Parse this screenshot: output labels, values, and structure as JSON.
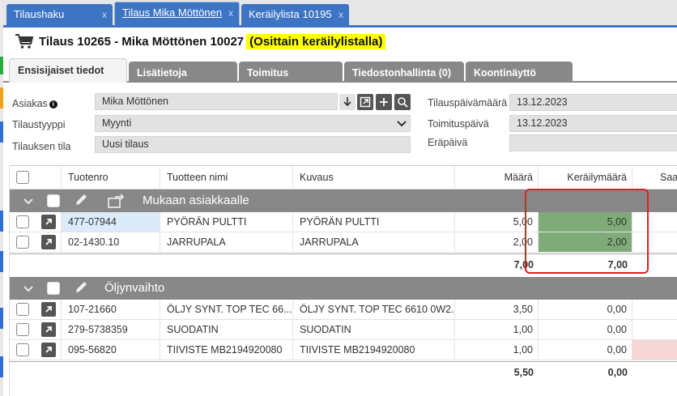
{
  "top_tabs": [
    {
      "label": "Tilaushaku",
      "close": "x"
    },
    {
      "label": "Tilaus Mika Möttönen",
      "close": "x"
    },
    {
      "label": "Keräilylista 10195",
      "close": "x"
    }
  ],
  "page_title": {
    "main": "Tilaus 10265 - Mika Möttönen 10027",
    "status": "(Osittain keräilylistalla)"
  },
  "sub_tabs": [
    "Ensisijaiset tiedot",
    "Lisätietoja",
    "Toimitus",
    "Tiedostonhallinta (0)",
    "Koontinäyttö"
  ],
  "form": {
    "asiakas_label": "Asiakas",
    "asiakas_value": "Mika Möttönen",
    "tilaustyyppi_label": "Tilaustyyppi",
    "tilaustyyppi_value": "Myynti",
    "tilauksen_tila_label": "Tilauksen tila",
    "tilauksen_tila_value": "Uusi tilaus",
    "tilauspaivamaara_label": "Tilauspäivämäärä",
    "tilauspaivamaara_value": "13.12.2023",
    "toimituspaiva_label": "Toimituspäivä",
    "toimituspaiva_value": "13.12.2023",
    "erapaiva_label": "Eräpäivä",
    "erapaiva_value": ""
  },
  "grid": {
    "headers": {
      "tuotenro": "Tuotenro",
      "nimi": "Tuotteen nimi",
      "kuvaus": "Kuvaus",
      "maara": "Määrä",
      "kerailymaara": "Keräilymäärä",
      "extra": "Saa"
    },
    "groups": [
      {
        "name": "Mukaan asiakkaalle",
        "rows": [
          {
            "tuotenro": "477-07944",
            "nimi": "PYÖRÄN PULTTI",
            "kuvaus": "PYÖRÄN PULTTI",
            "maara": "5,00",
            "kerailymaara": "5,00"
          },
          {
            "tuotenro": "02-1430.10",
            "nimi": "JARRUPALA",
            "kuvaus": "JARRUPALA",
            "maara": "2,00",
            "kerailymaara": "2,00"
          }
        ],
        "sum_maara": "7,00",
        "sum_kerailymaara": "7,00"
      },
      {
        "name": "Öljynvaihto",
        "rows": [
          {
            "tuotenro": "107-21660",
            "nimi": "ÖLJY SYNT. TOP TEC 66...",
            "kuvaus": "ÖLJY SYNT. TOP TEC 6610 0W2...",
            "maara": "3,50",
            "kerailymaara": "0,00"
          },
          {
            "tuotenro": "279-5738359",
            "nimi": "SUODATIN",
            "kuvaus": "SUODATIN",
            "maara": "1,00",
            "kerailymaara": "0,00"
          },
          {
            "tuotenro": "095-56820",
            "nimi": "TIIVISTE MB2194920080",
            "kuvaus": "TIIVISTE MB2194920080",
            "maara": "1,00",
            "kerailymaara": "0,00"
          }
        ],
        "sum_maara": "5,50",
        "sum_kerailymaara": "0,00"
      }
    ]
  },
  "colors": {
    "tab_blue": "#3d74c4",
    "group_gray": "#888888",
    "picked_green": "#7fab78",
    "highlight": "#ffff00",
    "annotation_red": "#e02020",
    "row_pink": "#f7d6d6"
  }
}
